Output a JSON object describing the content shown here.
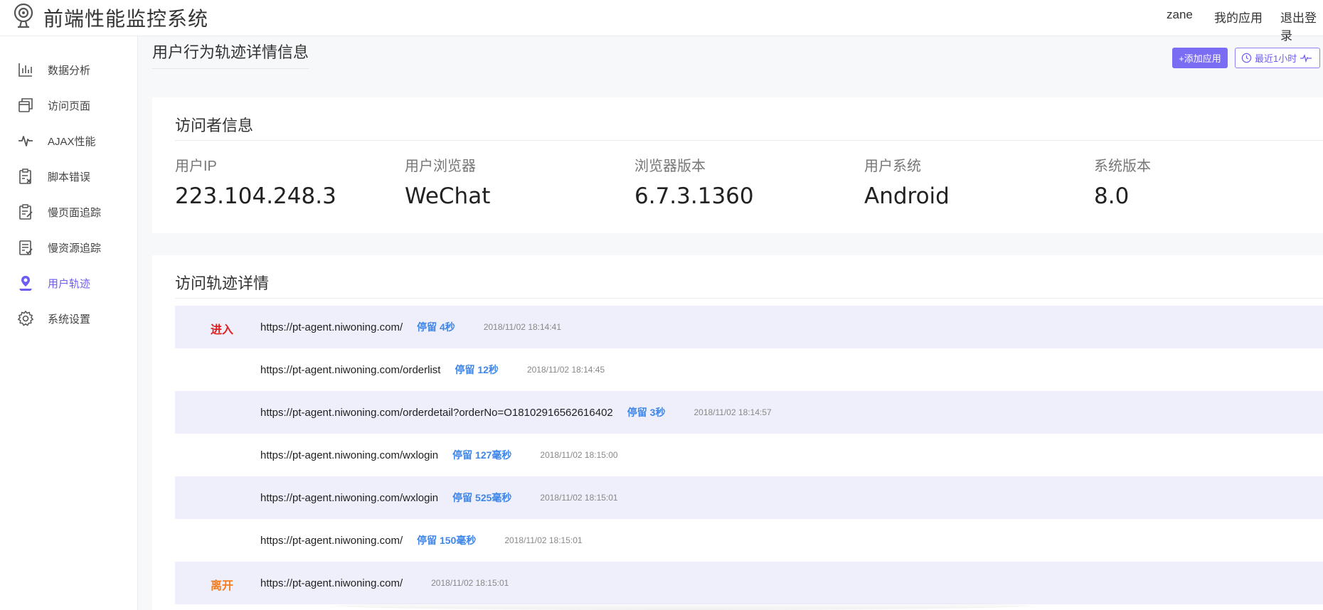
{
  "header": {
    "app_title": "前端性能监控系统",
    "user": "zane",
    "my_apps": "我的应用",
    "logout": "退出登录"
  },
  "sidebar": {
    "items": [
      {
        "label": "数据分析",
        "icon": "bar-chart-icon"
      },
      {
        "label": "访问页面",
        "icon": "pages-icon"
      },
      {
        "label": "AJAX性能",
        "icon": "pulse-icon"
      },
      {
        "label": "脚本错误",
        "icon": "script-error-icon"
      },
      {
        "label": "慢页面追踪",
        "icon": "slow-page-icon"
      },
      {
        "label": "慢资源追踪",
        "icon": "slow-resource-icon"
      },
      {
        "label": "用户轨迹",
        "icon": "user-track-icon",
        "active": true
      },
      {
        "label": "系统设置",
        "icon": "gear-icon"
      }
    ]
  },
  "main": {
    "page_title": "用户行为轨迹详情信息",
    "add_app_button": "+添加应用",
    "time_range_button": "最近1小时"
  },
  "visitor": {
    "title": "访问者信息",
    "fields": [
      {
        "label": "用户IP",
        "value": "223.104.248.3"
      },
      {
        "label": "用户浏览器",
        "value": "WeChat"
      },
      {
        "label": "浏览器版本",
        "value": "6.7.3.1360"
      },
      {
        "label": "用户系统",
        "value": "Android"
      },
      {
        "label": "系统版本",
        "value": "8.0"
      }
    ]
  },
  "track": {
    "title": "访问轨迹详情",
    "rows": [
      {
        "tag": "进入",
        "url": "https://pt-agent.niwoning.com/",
        "stay": "停留 4秒",
        "time": "2018/11/02 18:14:41"
      },
      {
        "tag": "",
        "url": "https://pt-agent.niwoning.com/orderlist",
        "stay": "停留 12秒",
        "time": "2018/11/02 18:14:45"
      },
      {
        "tag": "",
        "url": "https://pt-agent.niwoning.com/orderdetail?orderNo=O18102916562616402",
        "stay": "停留 3秒",
        "time": "2018/11/02 18:14:57"
      },
      {
        "tag": "",
        "url": "https://pt-agent.niwoning.com/wxlogin",
        "stay": "停留 127毫秒",
        "time": "2018/11/02 18:15:00"
      },
      {
        "tag": "",
        "url": "https://pt-agent.niwoning.com/wxlogin",
        "stay": "停留 525毫秒",
        "time": "2018/11/02 18:15:01"
      },
      {
        "tag": "",
        "url": "https://pt-agent.niwoning.com/",
        "stay": "停留 150毫秒",
        "time": "2018/11/02 18:15:01"
      },
      {
        "tag": "离开",
        "url": "https://pt-agent.niwoning.com/",
        "stay": "",
        "time": "2018/11/02 18:15:01"
      }
    ]
  },
  "colors": {
    "accent": "#6d5cf0",
    "enter_tag": "#e02020",
    "leave_tag": "#f57c1f",
    "stay_text": "#3f86e8",
    "row_stripe": "#eeeffa"
  }
}
